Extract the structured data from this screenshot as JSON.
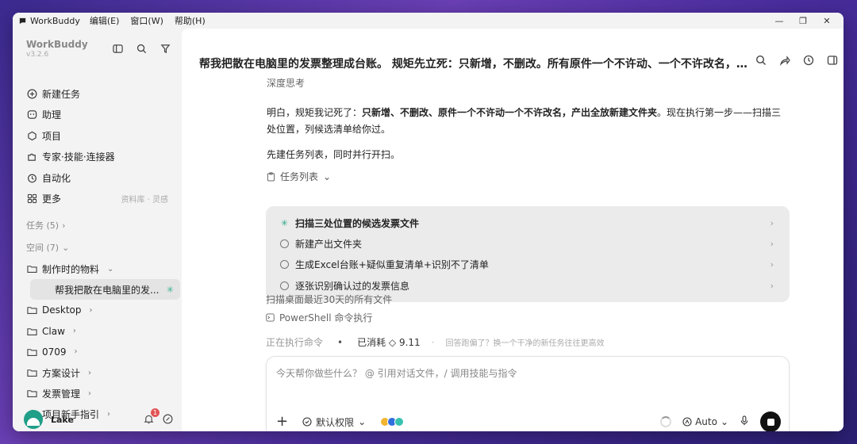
{
  "titlebar": {
    "app_name": "WorkBuddy",
    "menu": [
      "编辑(E)",
      "窗口(W)",
      "帮助(H)"
    ],
    "min": "—",
    "max": "❐",
    "close": "✕"
  },
  "sidebar": {
    "brand": "WorkBuddy",
    "version": "v3.2.6",
    "nav": [
      {
        "label": "新建任务",
        "icon": "plus-circle-icon"
      },
      {
        "label": "助理",
        "icon": "assistant-icon"
      },
      {
        "label": "项目",
        "icon": "project-icon"
      },
      {
        "label": "专家·技能·连接器",
        "icon": "puzzle-icon"
      },
      {
        "label": "自动化",
        "icon": "clock-icon"
      },
      {
        "label": "更多",
        "icon": "grid-icon",
        "extra": "资料库 · 灵感"
      }
    ],
    "tasks_section": "任务 (5)",
    "spaces_section": "空间 (7)",
    "tree": [
      {
        "label": "制作时的物料",
        "chev": "⌄"
      },
      {
        "label": "帮我把散在电脑里的发...",
        "active": true
      },
      {
        "label": "Desktop",
        "chev": "›"
      },
      {
        "label": "Claw",
        "chev": "›"
      },
      {
        "label": "0709",
        "chev": "›"
      },
      {
        "label": "方案设计",
        "chev": "›"
      },
      {
        "label": "发票管理",
        "chev": "›"
      },
      {
        "label": "项目新手指引",
        "chev": "›"
      }
    ],
    "user": {
      "name": "Lake",
      "badge": "1"
    }
  },
  "main": {
    "title": "帮我把散在电脑里的发票整理成台账。 规矩先立死：只新增，不删改。所有原件一个不许动、一个不许改名，整理后",
    "deep_thinking": "深度思考",
    "para1_a": "明白，规矩我记死了：",
    "para1_b": "只新增、不删改、原件一个不许动一个不许改名，产出全放新建文件夹",
    "para1_c": "。现在执行第一步——扫描三处位置，列候选清单给你过。",
    "para2": "先建任务列表，同时并行开扫。",
    "tasklist_label": "任务列表",
    "tasks": [
      {
        "label": "扫描三处位置的候选发票文件",
        "status": "running"
      },
      {
        "label": "新建产出文件夹",
        "status": "pending"
      },
      {
        "label": "生成Excel台账+疑似重复清单+识别不了清单",
        "status": "pending"
      },
      {
        "label": "逐张识别确认过的发票信息",
        "status": "pending"
      }
    ],
    "scan_text": "扫描桌面最近30天的所有文件",
    "ps_text": "PowerShell 命令执行",
    "status_running": "正在执行命令",
    "cost": "已消耗 ◇ 9.11",
    "tip": "回答跑偏了？换一个干净的新任务往往更高效",
    "input_placeholder": "今天帮你做些什么？ @ 引用对话文件，/ 调用技能与指令",
    "permission": "默认权限",
    "mode": "Auto"
  }
}
